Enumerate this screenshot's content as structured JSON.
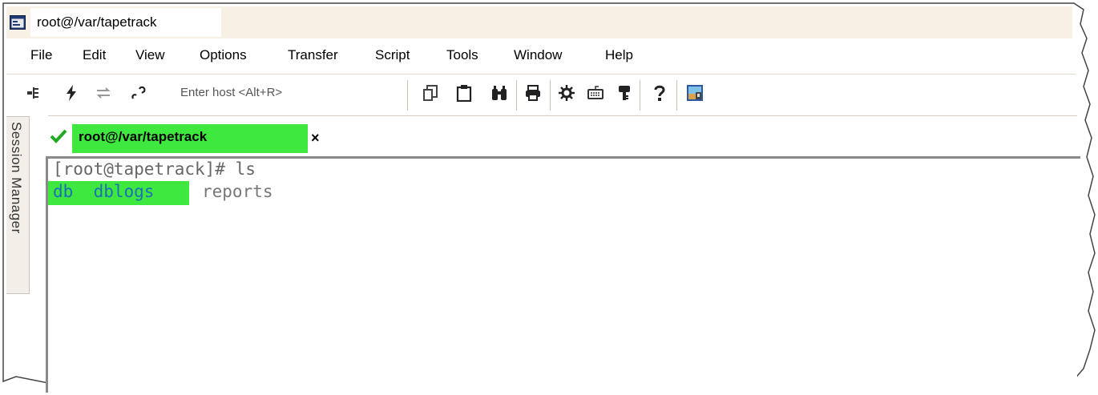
{
  "window": {
    "title": "root@/var/tapetrack"
  },
  "menu": {
    "items": [
      "File",
      "Edit",
      "View",
      "Options",
      "Transfer",
      "Script",
      "Tools",
      "Window",
      "Help"
    ]
  },
  "toolbar": {
    "host_placeholder": "Enter host <Alt+R>",
    "icons": [
      "connect-icon",
      "quick-connect-icon",
      "reconnect-icon",
      "disconnect-icon",
      "copy-icon",
      "paste-icon",
      "find-icon",
      "print-icon",
      "settings-icon",
      "keymap-icon",
      "key-icon",
      "help-icon",
      "sftp-icon"
    ]
  },
  "side": {
    "session_manager_label": "Session Manager"
  },
  "tabs": [
    {
      "label": "root@/var/tapetrack",
      "close": "×",
      "connected": true
    }
  ],
  "terminal": {
    "prompt_line": "[root@tapetrack]# ls",
    "ls_dirs": "db  dblogs",
    "ls_file": "reports"
  },
  "colors": {
    "titlebar_bg": "#f7f0e4",
    "highlight": "#3ee83e",
    "directory": "#1d6fb8",
    "check": "#22aa22"
  }
}
